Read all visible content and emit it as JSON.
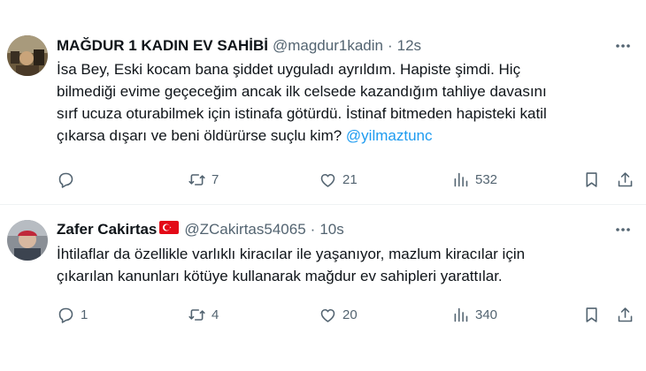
{
  "tweets": [
    {
      "name": "MAĞDUR 1 KADIN EV SAHİBİ",
      "flag": "",
      "handle": "@magdur1kadin",
      "dot": "·",
      "time": "12s",
      "text_lines": [
        "İsa Bey, Eski kocam bana şiddet uyguladı ayrıldım. Hapiste şimdi. Hiç",
        "bilmediği evime geçeceğim ancak ilk celsede kazandığım tahliye davasını",
        "sırf ucuza oturabilmek için istinafa götürdü. İstinaf bitmeden hapisteki katil",
        "çıkarsa dışarı ve beni öldürürse suçlu kim? "
      ],
      "mention": "@yilmaztunc",
      "replies": "",
      "retweets": "7",
      "likes": "21",
      "views": "532",
      "avatar_icon": "user-photo-avatar"
    },
    {
      "name": "Zafer Cakirtas",
      "flag": "🇹🇷",
      "handle": "@ZCakirtas54065",
      "dot": "·",
      "time": "10s",
      "text_lines": [
        "İhtilaflar da özellikle varlıklı kiracılar ile yaşanıyor, mazlum kiracılar için",
        "çıkarılan kanunları kötüye kullanarak mağdur ev sahipleri yarattılar."
      ],
      "replies": "1",
      "retweets": "4",
      "likes": "20",
      "views": "340",
      "avatar_icon": "user-photo-avatar"
    }
  ],
  "icons": {
    "reply": "reply-icon",
    "retweet": "retweet-icon",
    "like": "like-icon",
    "views": "views-icon",
    "bookmark": "bookmark-icon",
    "share": "share-icon",
    "more": "more-icon"
  },
  "colors": {
    "text": "#0f1419",
    "muted": "#536471",
    "link": "#1d9bf0",
    "divider": "#eff3f4"
  }
}
